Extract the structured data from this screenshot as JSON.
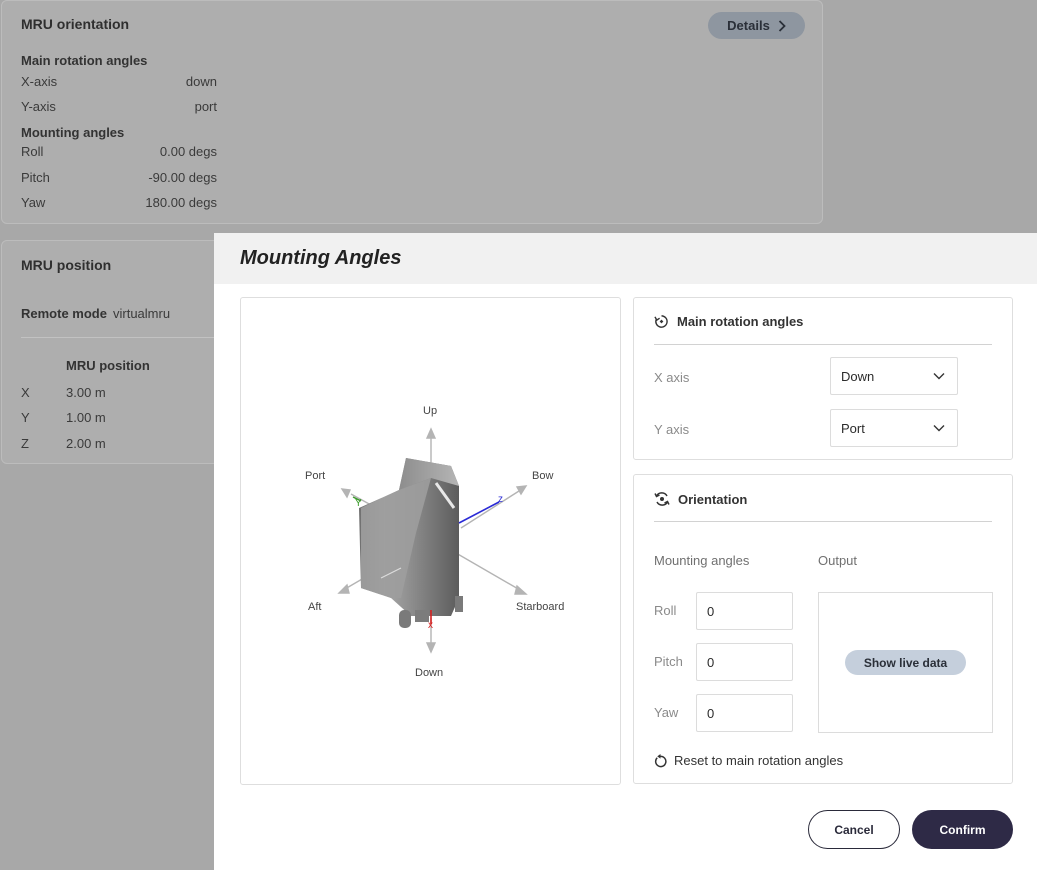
{
  "orientation_card": {
    "title": "MRU orientation",
    "details_label": "Details",
    "main_rotation_heading": "Main rotation angles",
    "x_axis_label": "X-axis",
    "x_axis_value": "down",
    "y_axis_label": "Y-axis",
    "y_axis_value": "port",
    "mounting_heading": "Mounting angles",
    "roll_label": "Roll",
    "roll_value": "0.00 degs",
    "pitch_label": "Pitch",
    "pitch_value": "-90.00 degs",
    "yaw_label": "Yaw",
    "yaw_value": "180.00 degs"
  },
  "position_card": {
    "title": "MRU position",
    "remote_mode_label": "Remote mode",
    "remote_mode_value": "virtualmru",
    "column_header": "MRU position",
    "rows": [
      {
        "axis": "X",
        "value": "3.00 m"
      },
      {
        "axis": "Y",
        "value": "1.00 m"
      },
      {
        "axis": "Z",
        "value": "2.00 m"
      }
    ]
  },
  "modal": {
    "title": "Mounting Angles",
    "viewer": {
      "labels": {
        "up": "Up",
        "down": "Down",
        "port": "Port",
        "bow": "Bow",
        "aft": "Aft",
        "starboard": "Starboard"
      },
      "axes": {
        "x": "x",
        "y": "Y",
        "z": "z"
      },
      "colors": {
        "x_axis": "#d62020",
        "y_axis": "#3a9a2a",
        "z_axis": "#2a2ad6"
      }
    },
    "main_rotation": {
      "title": "Main rotation angles",
      "x_axis_label": "X axis",
      "x_axis_value": "Down",
      "y_axis_label": "Y axis",
      "y_axis_value": "Port"
    },
    "orientation": {
      "title": "Orientation",
      "mounting_label": "Mounting angles",
      "output_label": "Output",
      "roll_label": "Roll",
      "roll_value": "0",
      "pitch_label": "Pitch",
      "pitch_value": "0",
      "yaw_label": "Yaw",
      "yaw_value": "0",
      "show_live_label": "Show live data",
      "reset_label": "Reset to main rotation angles"
    },
    "cancel_label": "Cancel",
    "confirm_label": "Confirm"
  },
  "colors": {
    "confirm_bg": "#2e2a46",
    "live_button_bg": "#c5cfdc",
    "details_button_bg": "#8e96a0"
  }
}
